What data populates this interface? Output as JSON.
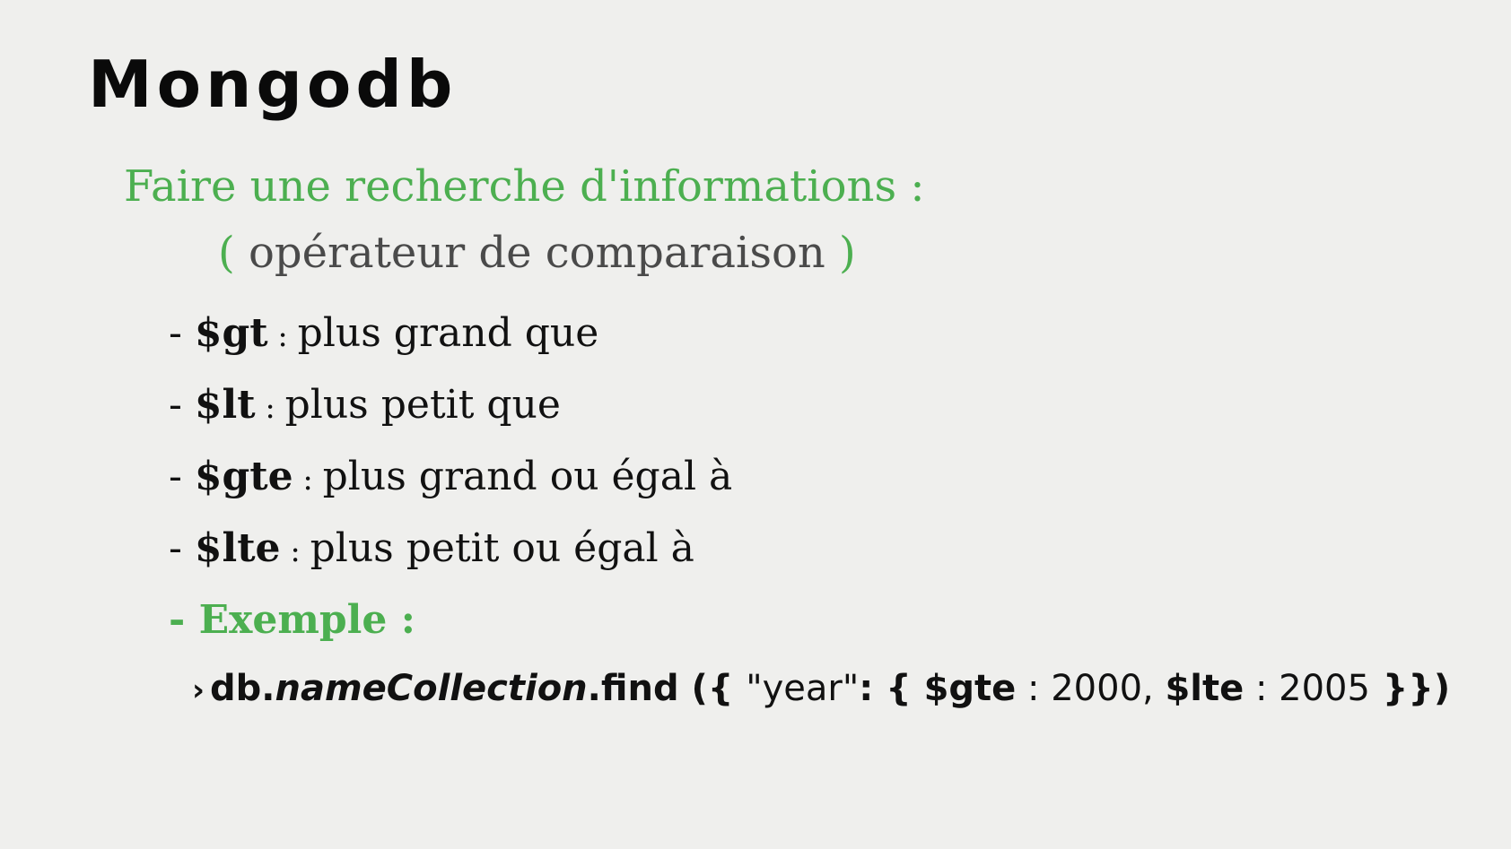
{
  "slide": {
    "title": "Mongodb",
    "subtitle": "Faire une recherche d'informations :",
    "subtitle2": {
      "open": "(",
      "text": " opérateur de comparaison ",
      "close": ")"
    },
    "bullets": [
      {
        "dash": "- ",
        "op": "$gt",
        "sep": " : ",
        "desc": "plus grand que"
      },
      {
        "dash": "- ",
        "op": "$lt",
        "sep": " : ",
        "desc": "plus petit que"
      },
      {
        "dash": "- ",
        "op": "$gte",
        "sep": " : ",
        "desc": "plus grand ou égal à"
      },
      {
        "dash": "- ",
        "op": "$lte",
        "sep": " : ",
        "desc": "plus petit ou égal à"
      }
    ],
    "example_label": "- Exemple :",
    "code": {
      "prompt": "›",
      "db": "db.",
      "collection": "nameCollection",
      "find": ".find ({ ",
      "key": "\"year\"",
      "colon_brace": ": { ",
      "gte": "$gte",
      "sep1": " : ",
      "val1": "2000,",
      "lte": "$lte",
      "sep2": " : ",
      "val2": "2005",
      "close": "  }})"
    }
  },
  "colors": {
    "background": "#efefed",
    "accent_green": "#4caf50",
    "text_dark": "#111111",
    "text_gray": "#4a4a4a"
  }
}
